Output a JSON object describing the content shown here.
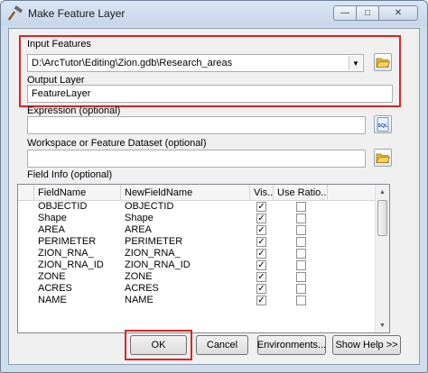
{
  "window": {
    "title": "Make Feature Layer",
    "minimize_glyph": "—",
    "maximize_glyph": "□",
    "close_glyph": "✕"
  },
  "form": {
    "input_features": {
      "label": "Input Features",
      "value": "D:\\ArcTutor\\Editing\\Zion.gdb\\Research_areas"
    },
    "output_layer": {
      "label": "Output Layer",
      "value": "FeatureLayer"
    },
    "expression": {
      "label": "Expression (optional)",
      "value": ""
    },
    "workspace": {
      "label": "Workspace or Feature Dataset (optional)",
      "value": ""
    },
    "field_info": {
      "label": "Field Info (optional)",
      "columns": [
        "FieldName",
        "NewFieldName",
        "Vis...",
        "Use Ratio..."
      ],
      "rows": [
        {
          "field": "OBJECTID",
          "new_field": "OBJECTID",
          "visible": "✓",
          "use_ratio": ""
        },
        {
          "field": "Shape",
          "new_field": "Shape",
          "visible": "✓",
          "use_ratio": ""
        },
        {
          "field": "AREA",
          "new_field": "AREA",
          "visible": "✓",
          "use_ratio": ""
        },
        {
          "field": "PERIMETER",
          "new_field": "PERIMETER",
          "visible": "✓",
          "use_ratio": ""
        },
        {
          "field": "ZION_RNA_",
          "new_field": "ZION_RNA_",
          "visible": "✓",
          "use_ratio": ""
        },
        {
          "field": "ZION_RNA_ID",
          "new_field": "ZION_RNA_ID",
          "visible": "✓",
          "use_ratio": ""
        },
        {
          "field": "ZONE",
          "new_field": "ZONE",
          "visible": "✓",
          "use_ratio": ""
        },
        {
          "field": "ACRES",
          "new_field": "ACRES",
          "visible": "✓",
          "use_ratio": ""
        },
        {
          "field": "NAME",
          "new_field": "NAME",
          "visible": "✓",
          "use_ratio": ""
        }
      ]
    }
  },
  "buttons": {
    "ok": "OK",
    "cancel": "Cancel",
    "environments": "Environments...",
    "show_help": "Show Help >>"
  },
  "icons": {
    "app": "hammer-icon",
    "browse": "folder-open-icon",
    "sql": "sql-icon",
    "sql_text": "SQL"
  },
  "colors": {
    "highlight_box": "#d6262b",
    "title_bar": "#c6d5e8"
  }
}
